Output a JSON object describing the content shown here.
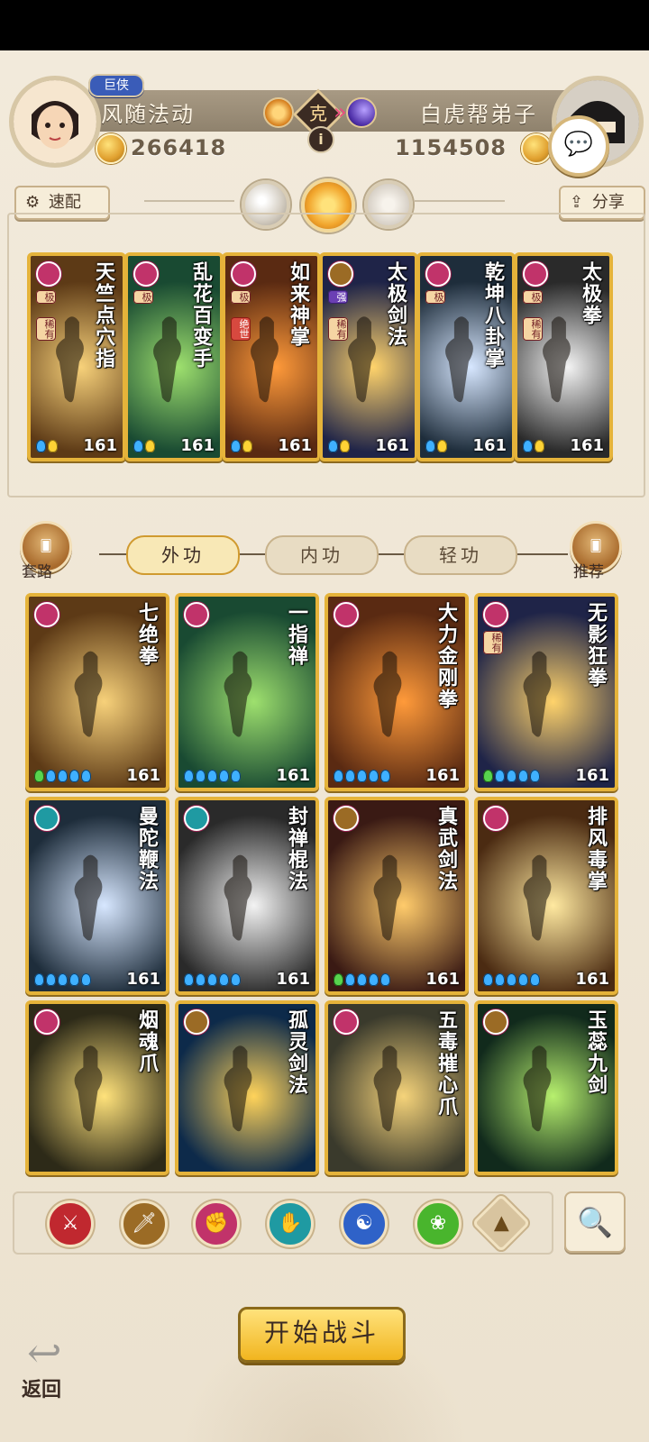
{
  "header": {
    "rank_badge": "巨侠",
    "player_left": {
      "name": "风随法动",
      "power": "266418"
    },
    "player_right": {
      "name": "白虎帮弟子",
      "power": "1154508"
    },
    "vs_label": "克",
    "info_label": "i",
    "chat_icon": "chat-icon"
  },
  "toolbar": {
    "quick_label": "速配",
    "share_label": "分享",
    "gear_icon": "⚙",
    "share_icon": "⇪"
  },
  "selected_cards": [
    {
      "title": "天竺点穴指",
      "level": "161",
      "tags": [
        "极",
        "稀有"
      ],
      "type": "pink"
    },
    {
      "title": "乱花百变手",
      "level": "161",
      "tags": [
        "极"
      ],
      "type": "pink"
    },
    {
      "title": "如来神掌",
      "level": "161",
      "tags": [
        "极",
        "绝世"
      ],
      "type": "pink"
    },
    {
      "title": "太极剑法",
      "level": "161",
      "tags": [
        "强",
        "稀有"
      ],
      "type": "bronze"
    },
    {
      "title": "乾坤八卦掌",
      "level": "161",
      "tags": [
        "极"
      ],
      "type": "pink"
    },
    {
      "title": "太极拳",
      "level": "161",
      "tags": [
        "极",
        "稀有"
      ],
      "type": "pink"
    }
  ],
  "side_buttons": {
    "left_label": "套路",
    "right_label": "推荐"
  },
  "tabs": {
    "tab1": "外功",
    "tab2": "内功",
    "tab3": "轻功"
  },
  "grid_cards": [
    {
      "title": "七绝拳",
      "level": "161",
      "type": "pink"
    },
    {
      "title": "一指禅",
      "level": "161",
      "type": "pink"
    },
    {
      "title": "大力金刚拳",
      "level": "161",
      "type": "pink"
    },
    {
      "title": "无影狂拳",
      "level": "161",
      "type": "pink",
      "tag": "稀有"
    },
    {
      "title": "曼陀鞭法",
      "level": "161",
      "type": "teal"
    },
    {
      "title": "封禅棍法",
      "level": "161",
      "type": "teal"
    },
    {
      "title": "真武剑法",
      "level": "161",
      "type": "bronze"
    },
    {
      "title": "排风毒掌",
      "level": "161",
      "type": "pink"
    },
    {
      "title": "烟魂爪",
      "level": "",
      "type": "pink"
    },
    {
      "title": "孤灵剑法",
      "level": "",
      "type": "bronze"
    },
    {
      "title": "五毒摧心爪",
      "level": "",
      "type": "pink"
    },
    {
      "title": "玉蕊九剑",
      "level": "",
      "type": "bronze"
    }
  ],
  "filters": {
    "icons": [
      "sword-icon",
      "dagger-icon",
      "fist-icon",
      "palm-icon",
      "yin-yang-icon",
      "wind-icon",
      "other-icon"
    ],
    "search_icon": "🔍"
  },
  "buttons": {
    "start_battle": "开始战斗",
    "back": "返回",
    "back_icon": "↩"
  },
  "colors": {
    "pink": "#c1336a",
    "teal": "#1f9aa2",
    "bronze": "#9b6b25",
    "gold": "#e5b33a"
  }
}
